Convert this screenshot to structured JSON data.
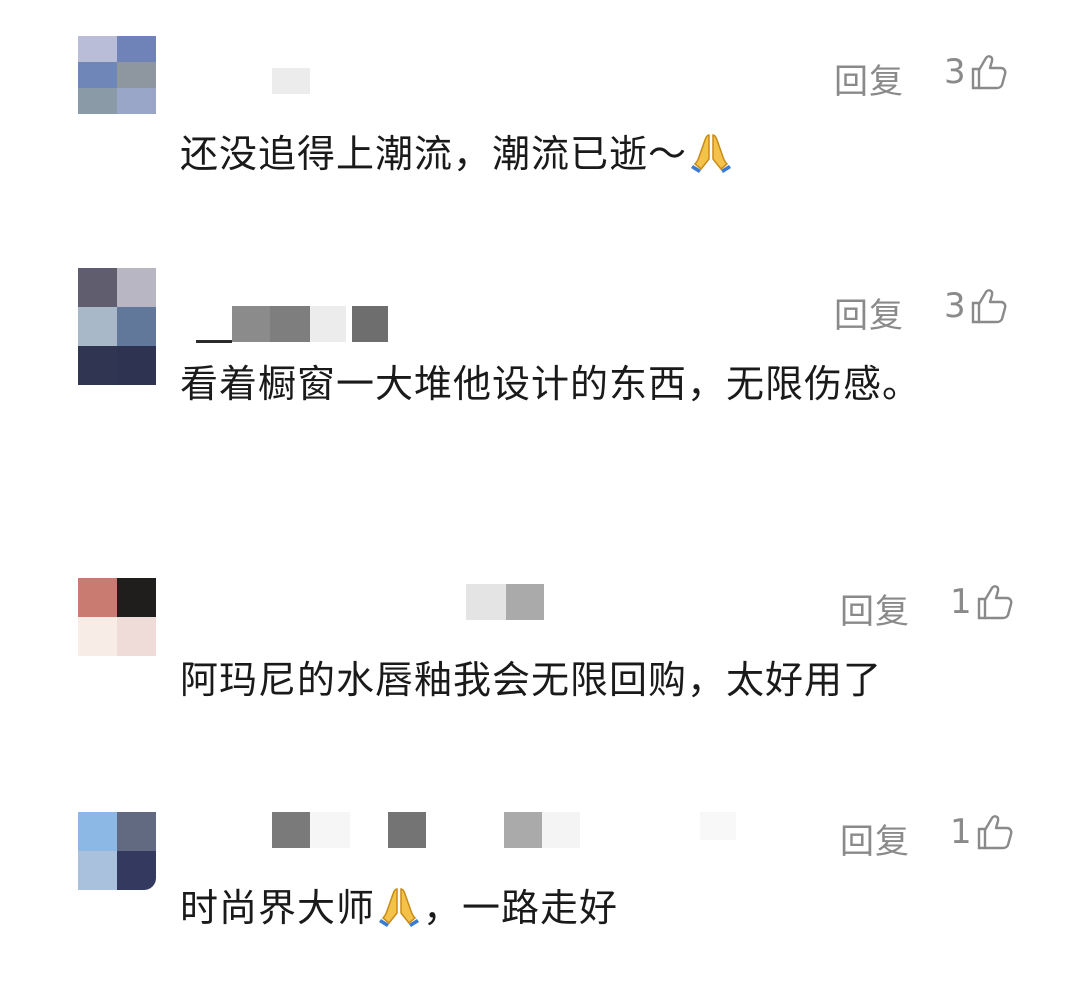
{
  "comments": [
    {
      "reply_label": "回复",
      "like_count": "3",
      "text_before": "还没追得上潮流，潮流已逝～",
      "text_after": "",
      "emoji": "folded-hands",
      "avatar_colors": [
        "#b9bdd8",
        "#6f83b9",
        "#6e87b8",
        "#8e979f",
        "#8a9aa6",
        "#9aa6c8"
      ]
    },
    {
      "reply_label": "回复",
      "like_count": "3",
      "text_before": "看着橱窗一大堆他设计的东西，无限伤感。",
      "text_after": "",
      "emoji": "",
      "avatar_colors": [
        "#5f5d6e",
        "#b9b6c4",
        "#a9b8c8",
        "#62789a",
        "#303552",
        "#2d3350"
      ]
    },
    {
      "reply_label": "回复",
      "like_count": "1",
      "text_before": "阿玛尼的水唇釉我会无限回购，太好用了",
      "text_after": "",
      "emoji": "",
      "avatar_colors": [
        "#c97b72",
        "#1f1e1c",
        "#f7ede6",
        "#efdcd9",
        "#ffffff",
        "#ffffff"
      ]
    },
    {
      "reply_label": "回复",
      "like_count": "1",
      "text_before": "时尚界大师",
      "text_after": "，一路走好",
      "emoji": "folded-hands",
      "avatar_colors": [
        "#8cb8e6",
        "#616a80",
        "#a9c1dd",
        "#33395f",
        "#ffffff",
        "#ffffff"
      ]
    }
  ]
}
